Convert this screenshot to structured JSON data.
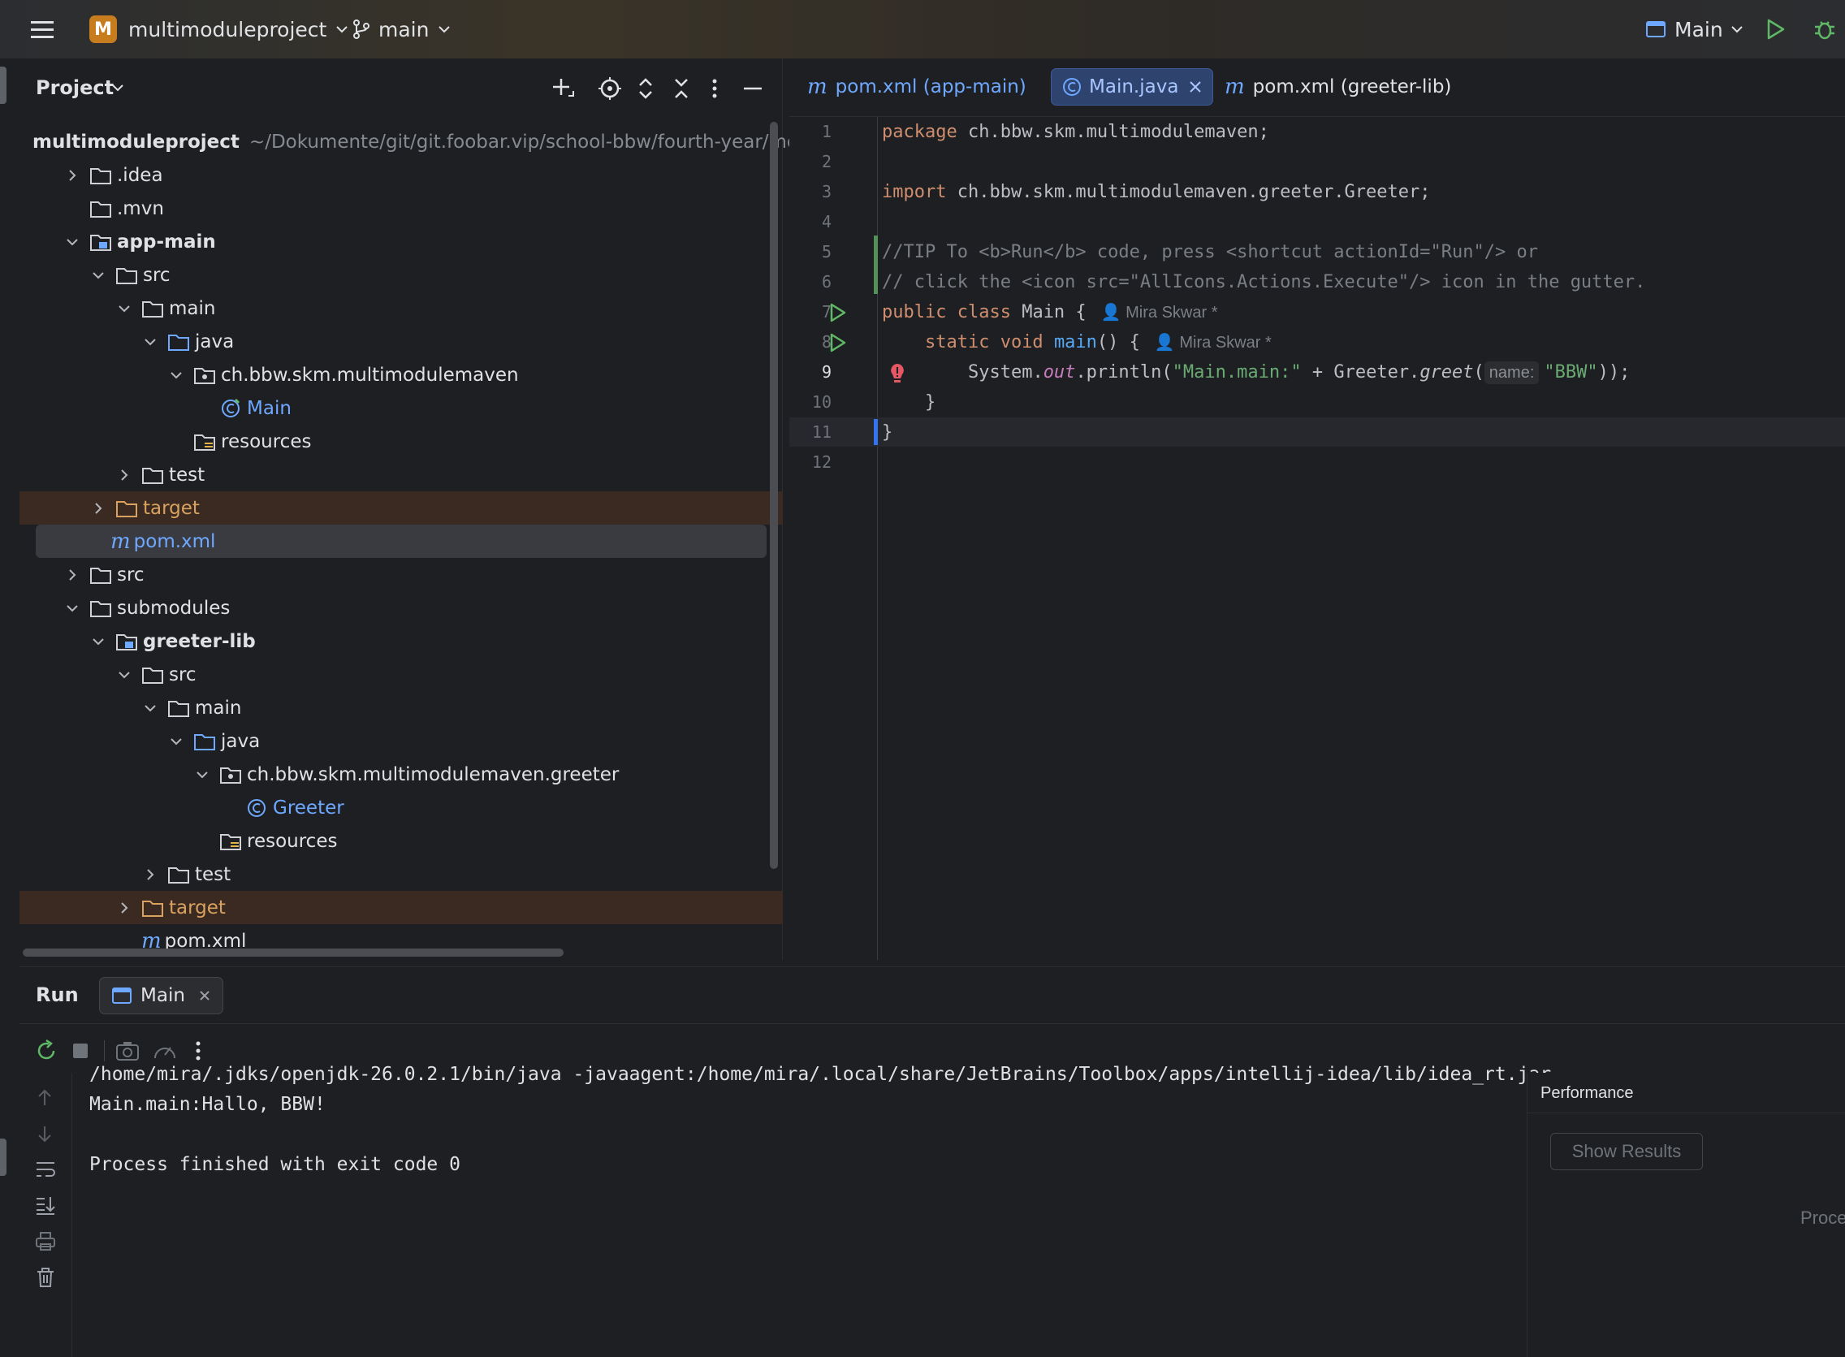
{
  "topbar": {
    "project_badge": "M",
    "project_name": "multimoduleproject",
    "branch": "main",
    "run_config": "Main"
  },
  "project_panel": {
    "title": "Project",
    "tree": [
      {
        "label": "multimoduleproject",
        "path": "~/Dokumente/git/git.foobar.vip/school-bbw/fourth-year/mo"
      },
      {
        "label": ".idea"
      },
      {
        "label": ".mvn"
      },
      {
        "label": "app-main"
      },
      {
        "label": "src"
      },
      {
        "label": "main"
      },
      {
        "label": "java"
      },
      {
        "label": "ch.bbw.skm.multimodulemaven"
      },
      {
        "label": "Main"
      },
      {
        "label": "resources"
      },
      {
        "label": "test"
      },
      {
        "label": "target"
      },
      {
        "label": "pom.xml"
      },
      {
        "label": "src"
      },
      {
        "label": "submodules"
      },
      {
        "label": "greeter-lib"
      },
      {
        "label": "src"
      },
      {
        "label": "main"
      },
      {
        "label": "java"
      },
      {
        "label": "ch.bbw.skm.multimodulemaven.greeter"
      },
      {
        "label": "Greeter"
      },
      {
        "label": "resources"
      },
      {
        "label": "test"
      },
      {
        "label": "target"
      },
      {
        "label": "pom.xml"
      }
    ]
  },
  "editor": {
    "tabs": [
      {
        "label": "pom.xml (app-main)"
      },
      {
        "label": "Main.java"
      },
      {
        "label": "pom.xml (greeter-lib)"
      }
    ],
    "line_numbers": [
      "1",
      "2",
      "3",
      "4",
      "5",
      "6",
      "7",
      "8",
      "9",
      "10",
      "11",
      "12"
    ],
    "code": {
      "l1_kw": "package",
      "l1_rest": " ch.bbw.skm.multimodulemaven;",
      "l3_kw": "import",
      "l3_rest": " ch.bbw.skm.multimodulemaven.greeter.Greeter;",
      "l5": "//TIP To <b>Run</b> code, press <shortcut actionId=\"Run\"/> or",
      "l6": "// click the <icon src=\"AllIcons.Actions.Execute\"/> icon in the gutter.",
      "l7_kw": "public class",
      "l7_rest": " Main {",
      "l7_author": "Mira Skwar *",
      "l8_kw": "static void",
      "l8_fn": "main",
      "l8_rest": "() {",
      "l8_author": "Mira Skwar *",
      "l9_a": "System.",
      "l9_out": "out",
      "l9_b": ".println(",
      "l9_str1": "\"Main.main:\"",
      "l9_c": " + Greeter.",
      "l9_greet": "greet",
      "l9_d": "(",
      "l9_hint": "name:",
      "l9_str2": "\"BBW\"",
      "l9_e": "));",
      "l10": "}",
      "l11": "}"
    }
  },
  "run_panel": {
    "title": "Run",
    "tab_label": "Main",
    "console": [
      "/home/mira/.jdks/openjdk-26.0.2.1/bin/java -javaagent:/home/mira/.local/share/JetBrains/Toolbox/apps/intellij-idea/lib/idea_rt.jar",
      "Main.main:Hallo, BBW!",
      "",
      "Process finished with exit code 0"
    ],
    "performance_title": "Performance",
    "show_results": "Show Results",
    "truncated_label": "Proce"
  }
}
